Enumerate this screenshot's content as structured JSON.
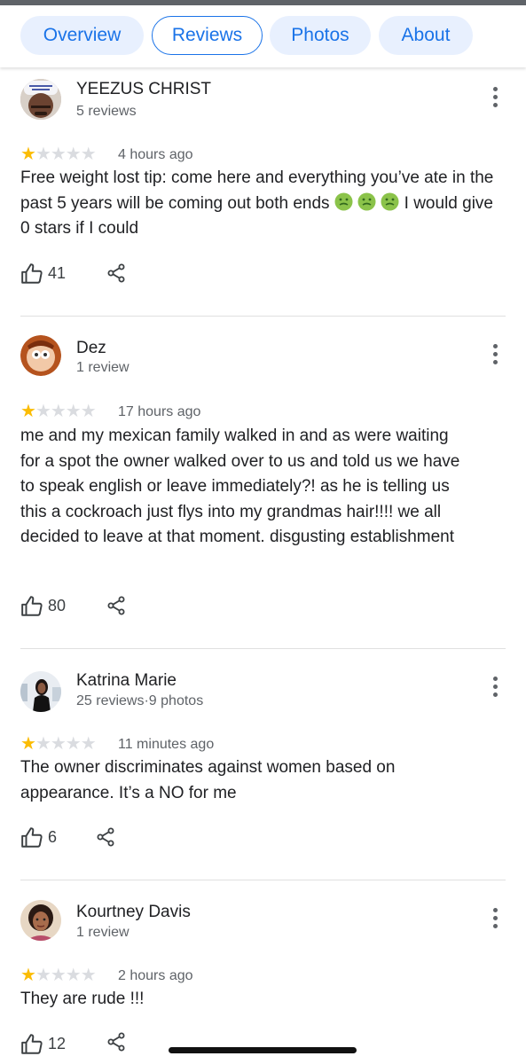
{
  "tabs": {
    "overview": "Overview",
    "reviews": "Reviews",
    "photos": "Photos",
    "about": "About"
  },
  "reviews": [
    {
      "name": "YEEZUS CHRIST",
      "meta": "5 reviews",
      "rating": 1,
      "time": "4 hours ago",
      "text_a": "Free weight lost tip: come here and everything you’ve ate in the past 5 years will be coming out both ends",
      "text_b": "I would give 0 stars if I could",
      "likes": "41"
    },
    {
      "name": "Dez",
      "meta": "1 review",
      "rating": 1,
      "time": "17 hours ago",
      "text": "me and my mexican family walked in and as were waiting for a spot the owner walked over to us and told us we have to speak english or leave immediately?! as he is telling us this a cockroach just flys into my grandmas hair!!!! we all decided to leave at that moment. disgusting establishment",
      "likes": "80"
    },
    {
      "name": "Katrina Marie",
      "meta": "25 reviews·9 photos",
      "rating": 1,
      "time": "11 minutes ago",
      "text": "The owner discriminates against women based on appearance. It’s a NO for me",
      "likes": "6"
    },
    {
      "name": "Kourtney Davis",
      "meta": "1 review",
      "rating": 1,
      "time": "2 hours ago",
      "text": "They are rude !!!",
      "likes": "12"
    }
  ],
  "colors": {
    "accent": "#1a73e8",
    "star": "#fbbc04",
    "star_empty": "#dadce0",
    "muted": "#5f6368"
  },
  "icons": [
    "thumbs-up-icon",
    "share-icon",
    "more-vert-icon",
    "nauseated-face-emoji"
  ]
}
